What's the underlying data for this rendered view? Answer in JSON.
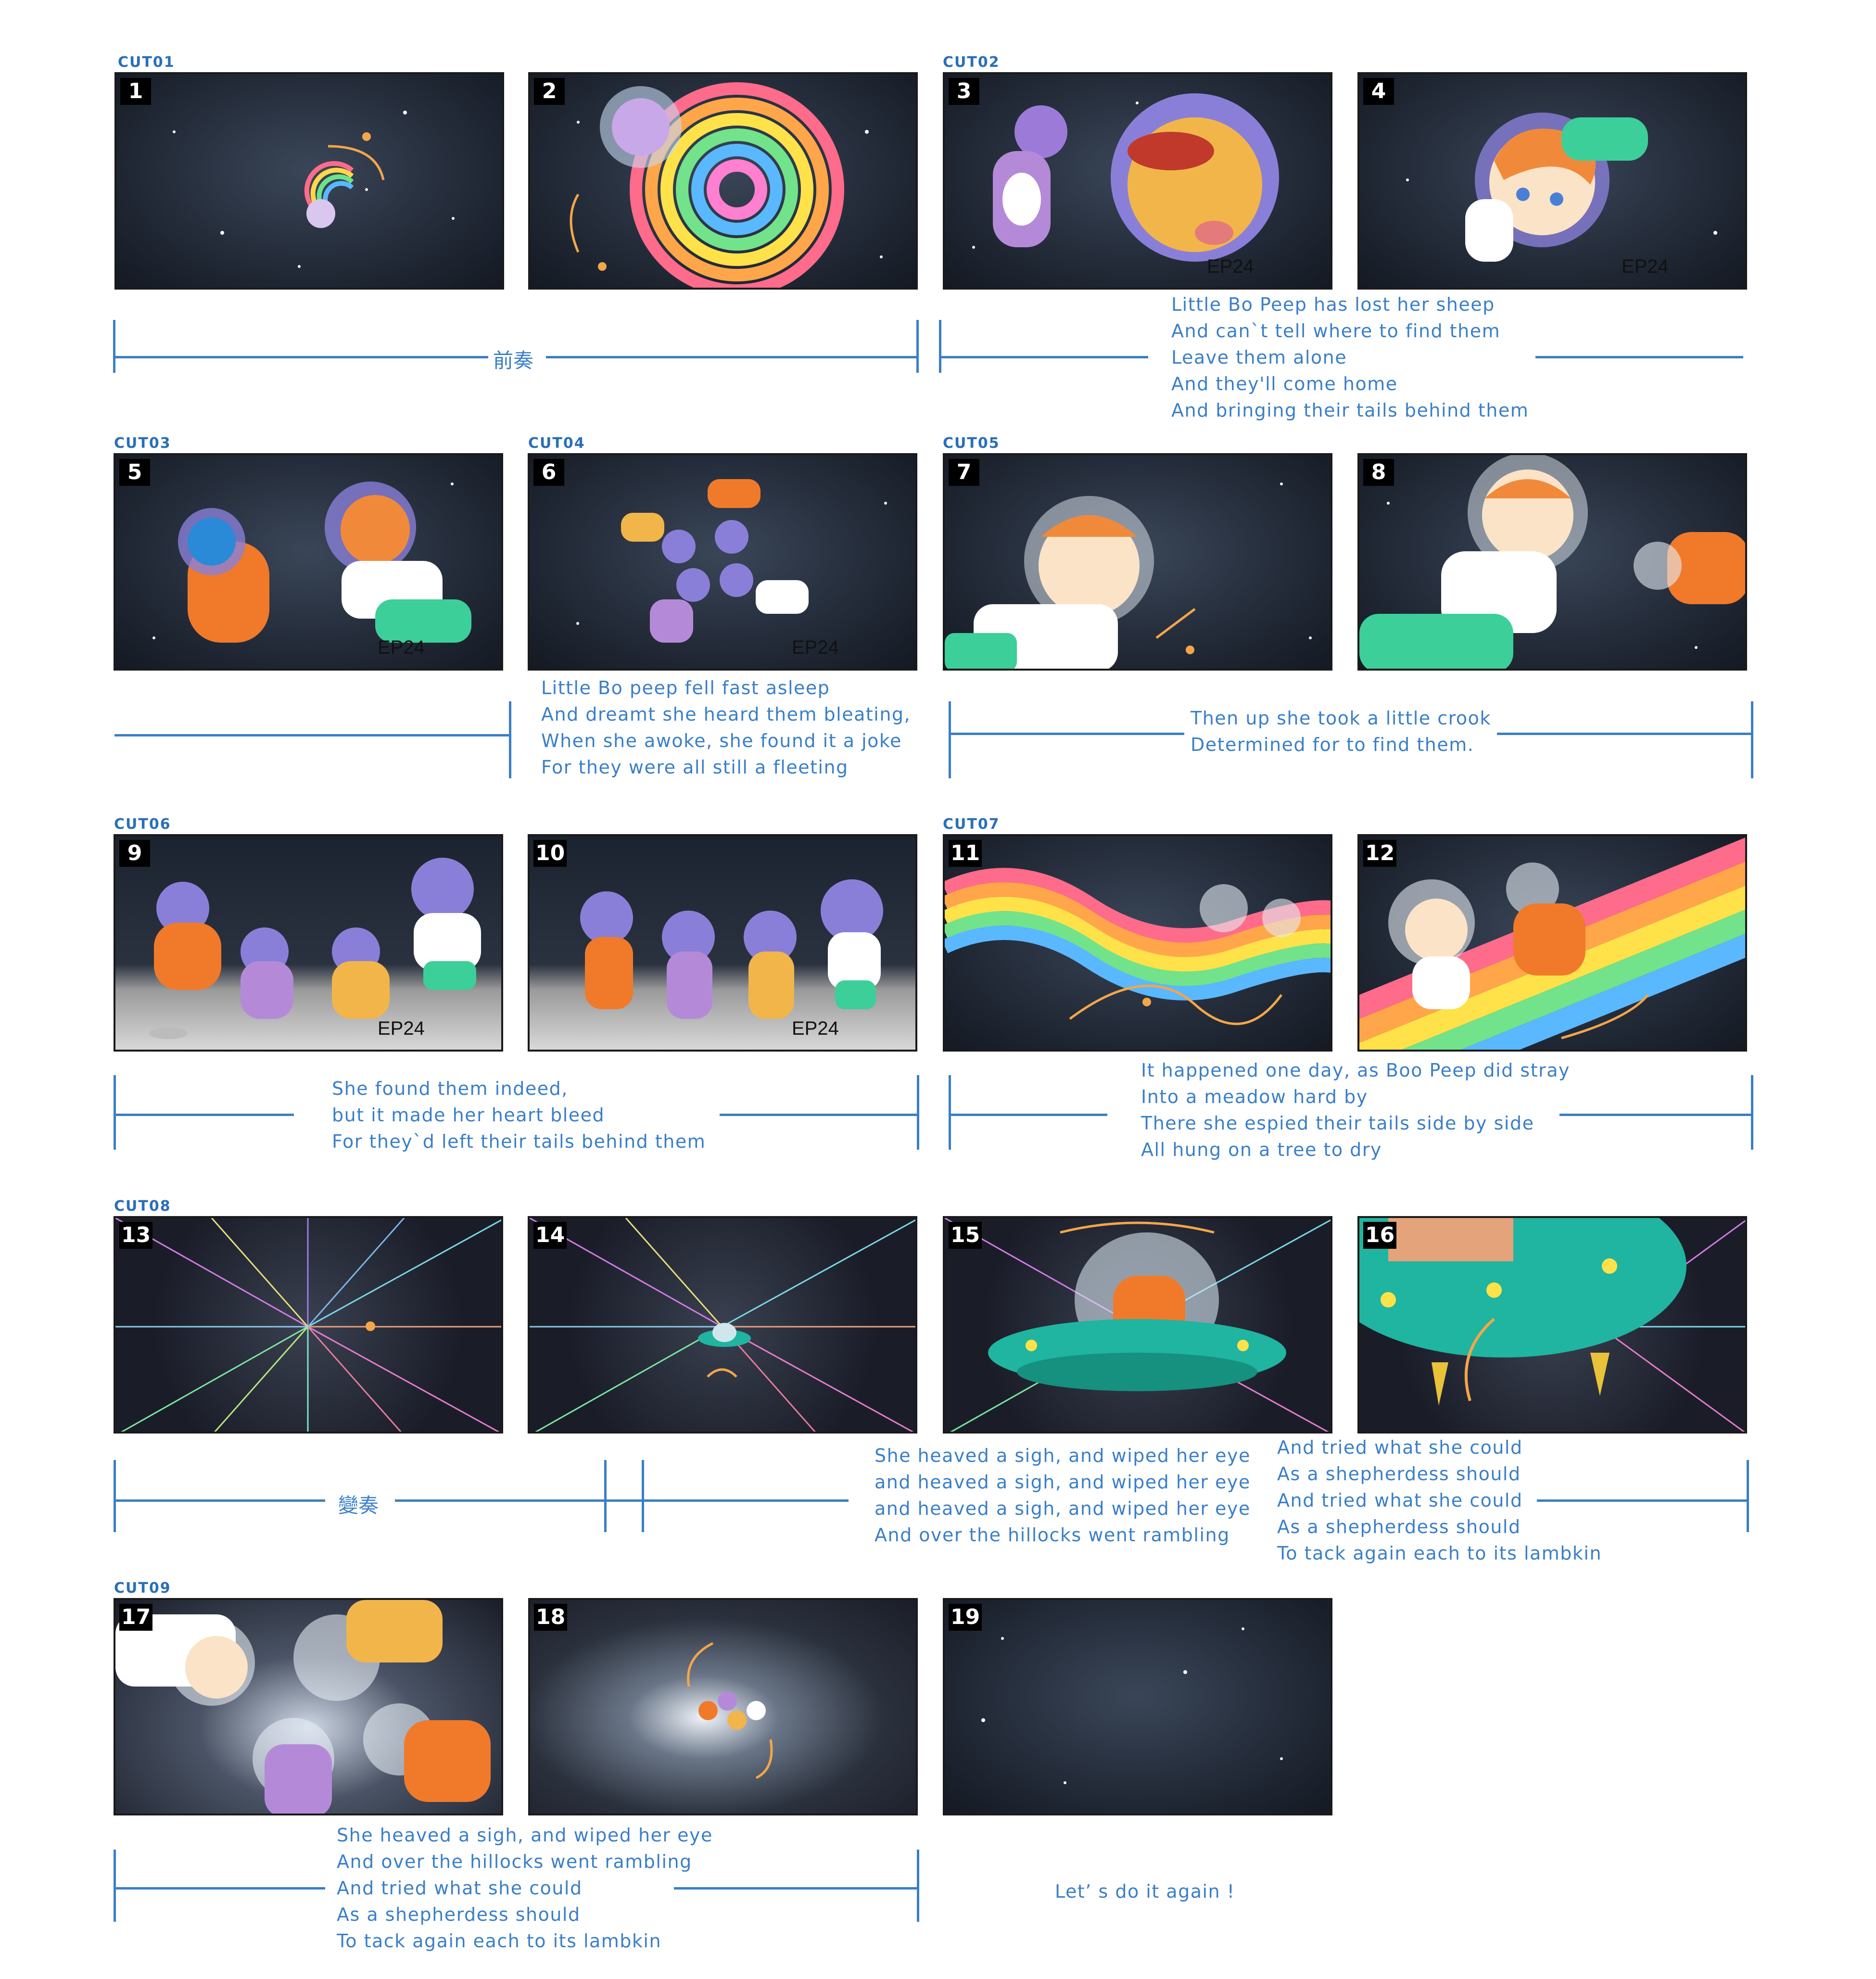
{
  "cuts": [
    "CUT01",
    "CUT02",
    "CUT03",
    "CUT04",
    "CUT05",
    "CUT06",
    "CUT07",
    "CUT08",
    "CUT09"
  ],
  "panels": [
    "1",
    "2",
    "3",
    "4",
    "5",
    "6",
    "7",
    "8",
    "9",
    "10",
    "11",
    "12",
    "13",
    "14",
    "15",
    "16",
    "17",
    "18",
    "19"
  ],
  "episode_tag": "EP24",
  "labels": {
    "intro": "前奏",
    "interlude": "變奏",
    "ending": "Let’ s do it again !"
  },
  "lyrics": {
    "row1": "Little Bo Peep has lost her sheep\nAnd can`t tell where to find them\nLeave them alone\nAnd they'll come home\nAnd bringing their tails behind them",
    "row2a": "Little Bo peep fell fast asleep\nAnd dreamt she heard them bleating,\nWhen she awoke, she found it a joke\nFor they were all still a fleeting",
    "row2b": "Then up she took a little crook\nDetermined for to find them.",
    "row3a": "She found them indeed,\nbut it made her heart bleed\nFor they`d left their tails behind them",
    "row3b": "It happened one day, as Boo Peep did stray\nInto a meadow hard by\nThere she espied their tails side by side\nAll hung on a tree to dry",
    "row4a": "She heaved a sigh, and wiped her eye\nand heaved a sigh, and wiped her eye\nand heaved a sigh, and wiped her eye\nAnd over the hillocks went rambling",
    "row4b": "And tried what she could\nAs a shepherdess should\nAnd tried what she could\nAs a shepherdess should\nTo tack again each to its lambkin",
    "row5": "She heaved a sigh, and wiped her eye\nAnd over the hillocks went rambling\nAnd tried what she could\nAs a shepherdess should\nTo tack again each to its lambkin"
  },
  "colors": {
    "timeline_blue": "#3a7fc8",
    "panel_border": "#1a1a1a",
    "space_dark": "#1c2330"
  }
}
